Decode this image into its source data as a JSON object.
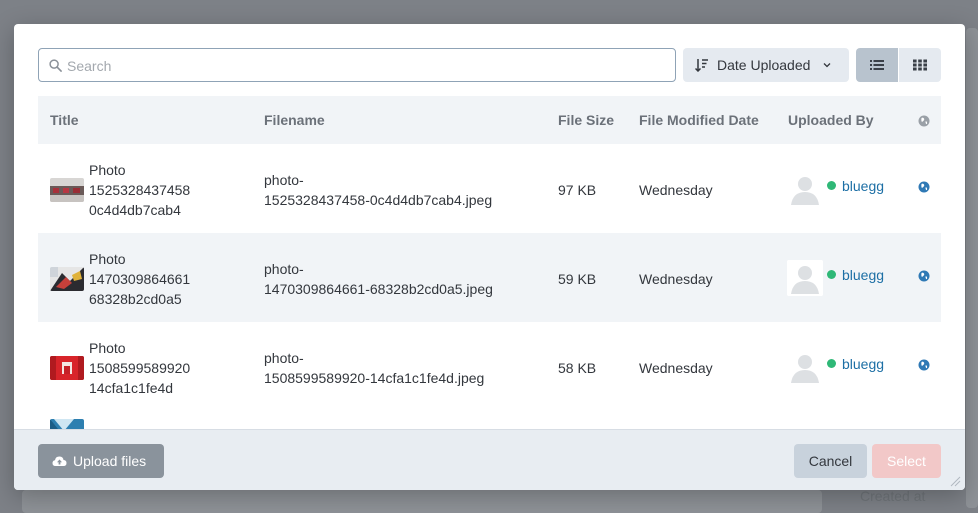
{
  "search": {
    "placeholder": "Search",
    "value": ""
  },
  "sort": {
    "label": "Date Uploaded"
  },
  "view": {
    "active": "list"
  },
  "table": {
    "headers": {
      "title": "Title",
      "filename": "Filename",
      "size": "File Size",
      "modified": "File Modified Date",
      "uploaded_by": "Uploaded By"
    },
    "rows": [
      {
        "title_lines": [
          "Photo",
          "1525328437458",
          "0c4d4db7cab4"
        ],
        "filename_lines": [
          "photo-",
          "1525328437458-0c4d4db7cab4.jpeg"
        ],
        "size": "97 KB",
        "modified": "Wednesday",
        "user": "bluegg"
      },
      {
        "title_lines": [
          "Photo",
          "1470309864661",
          "68328b2cd0a5"
        ],
        "filename_lines": [
          "photo-",
          "1470309864661-68328b2cd0a5.jpeg"
        ],
        "size": "59 KB",
        "modified": "Wednesday",
        "user": "bluegg"
      },
      {
        "title_lines": [
          "Photo",
          "1508599589920",
          "14cfa1c1fe4d"
        ],
        "filename_lines": [
          "photo-",
          "1508599589920-14cfa1c1fe4d.jpeg"
        ],
        "size": "58 KB",
        "modified": "Wednesday",
        "user": "bluegg"
      }
    ]
  },
  "footer": {
    "upload_label": "Upload files",
    "cancel_label": "Cancel",
    "select_label": "Select"
  },
  "background": {
    "created_label": "Created at"
  },
  "colors": {
    "accent": "#1d6fa5",
    "online": "#2fb877",
    "select_disabled": "#f2c8c8"
  },
  "icons": {
    "search": "search-icon",
    "sort": "sort-icon",
    "chevron": "chevron-down-icon",
    "list": "list-view-icon",
    "grid": "grid-view-icon",
    "globe": "globe-icon",
    "upload": "cloud-upload-icon",
    "avatar": "user-avatar-icon"
  }
}
